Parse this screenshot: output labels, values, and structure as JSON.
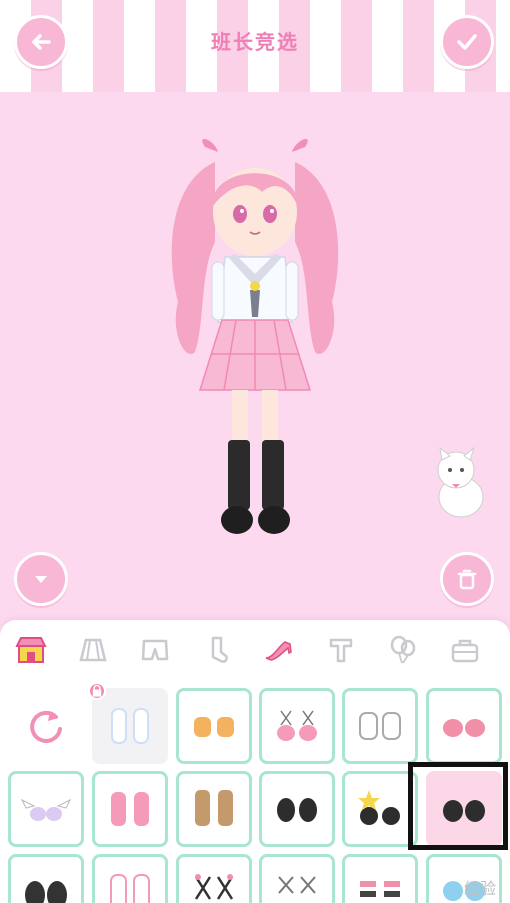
{
  "header": {
    "title": "班长竞选"
  },
  "buttons": {
    "back": "back-arrow-icon",
    "confirm": "checkmark-icon",
    "collapse": "chevron-down-icon",
    "delete": "trash-icon"
  },
  "categories": [
    {
      "name": "shop",
      "icon": "shop-icon",
      "active": true
    },
    {
      "name": "skirt",
      "icon": "skirt-icon"
    },
    {
      "name": "shorts",
      "icon": "shorts-icon"
    },
    {
      "name": "socks",
      "icon": "sock-icon"
    },
    {
      "name": "shoes",
      "icon": "high-heel-icon"
    },
    {
      "name": "tops",
      "icon": "shirt-icon"
    },
    {
      "name": "balloons",
      "icon": "balloon-icon"
    },
    {
      "name": "bag",
      "icon": "bag-icon"
    }
  ],
  "items": [
    {
      "icon": "reset-icon"
    },
    {
      "icon": "white-sneakers",
      "locked": true,
      "color": "#cfdff7"
    },
    {
      "icon": "orange-sandals",
      "color": "#f4b25f"
    },
    {
      "icon": "pink-ribbon-shoes",
      "color": "#f59bb9"
    },
    {
      "icon": "white-sandals",
      "color": "#e6e6e6"
    },
    {
      "icon": "pink-flats",
      "color": "#f28fa8"
    },
    {
      "icon": "winged-shoes",
      "color": "#dccaf2"
    },
    {
      "icon": "pink-sneakers",
      "color": "#f59bb9"
    },
    {
      "icon": "brown-boots",
      "color": "#c49a6c"
    },
    {
      "icon": "black-mary-janes",
      "color": "#2d2d2d"
    },
    {
      "icon": "star-shoes",
      "color": "#f6d64a"
    },
    {
      "icon": "black-loafers",
      "color": "#2d2d2d",
      "selected": true
    },
    {
      "icon": "black-cat-shoes",
      "color": "#333333"
    },
    {
      "icon": "white-pink-shoes",
      "color": "#f59bb9"
    },
    {
      "icon": "heart-lace-shoes",
      "color": "#f28fa8"
    },
    {
      "icon": "lace-up-shoes",
      "color": "#777777"
    },
    {
      "icon": "black-pink-shoes",
      "color": "#444444"
    },
    {
      "icon": "blue-cat-shoes",
      "color": "#8fd0ef"
    }
  ],
  "watermark": "经验",
  "colors": {
    "accent": "#f9b7d6",
    "slot_border": "#a9e6cf",
    "background": "#fdd9ef"
  }
}
